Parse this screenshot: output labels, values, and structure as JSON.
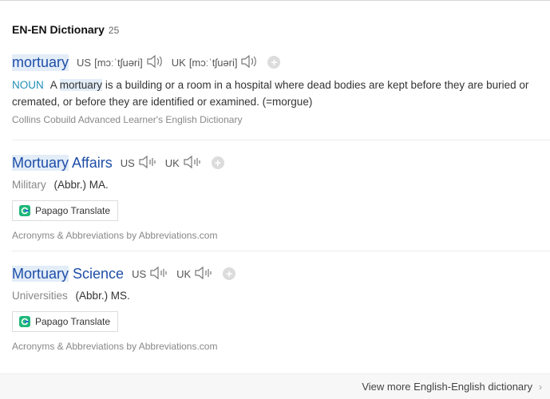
{
  "section": {
    "title": "EN-EN Dictionary",
    "count": "25"
  },
  "entries": [
    {
      "word": "mortuary",
      "us_label": "US",
      "us_ipa": "[mɔːˈtʃuəri]",
      "uk_label": "UK",
      "uk_ipa": "[mɔːˈtʃuəri]",
      "pos": "NOUN",
      "def_pre": "A",
      "def_word": "mortuary",
      "def_post": "is a building or a room in a hospital where dead bodies are kept before they are buried or cremated, or before they are identified or examined. (=morgue)",
      "source": "Collins Cobuild Advanced Learner's English Dictionary"
    },
    {
      "word_hl": "Mortuary",
      "word_rest": "Affairs",
      "us_label": "US",
      "uk_label": "UK",
      "category": "Military",
      "abbr": "(Abbr.) MA.",
      "translate": "Papago Translate",
      "source": "Acronyms & Abbreviations by Abbreviations.com"
    },
    {
      "word_hl": "Mortuary",
      "word_rest": "Science",
      "us_label": "US",
      "uk_label": "UK",
      "category": "Universities",
      "abbr": "(Abbr.) MS.",
      "translate": "Papago Translate",
      "source": "Acronyms & Abbreviations by Abbreviations.com"
    }
  ],
  "footer": {
    "more": "View more English-English dictionary"
  }
}
